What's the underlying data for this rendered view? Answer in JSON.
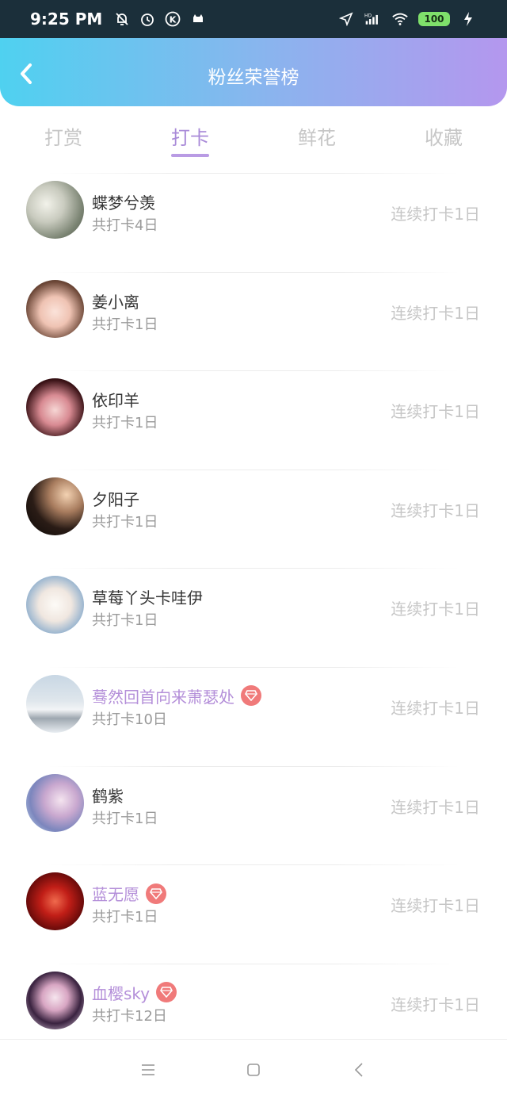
{
  "status_bar": {
    "time": "9:25 PM",
    "battery": "100",
    "icons": [
      "mute-bell-icon",
      "alarm-icon",
      "k-icon",
      "cat-icon",
      "location-icon",
      "signal-icon",
      "wifi-icon",
      "charging-icon"
    ]
  },
  "header": {
    "title": "粉丝荣誉榜",
    "back_icon": "chevron-left-icon"
  },
  "tabs": [
    {
      "label": "打赏",
      "active": false
    },
    {
      "label": "打卡",
      "active": true
    },
    {
      "label": "鲜花",
      "active": false
    },
    {
      "label": "收藏",
      "active": false
    }
  ],
  "fans": [
    {
      "name": "蝶梦兮羡",
      "total": "共打卡4日",
      "streak": "连续打卡1日",
      "vip": false
    },
    {
      "name": "姜小离",
      "total": "共打卡1日",
      "streak": "连续打卡1日",
      "vip": false
    },
    {
      "name": "依印羊",
      "total": "共打卡1日",
      "streak": "连续打卡1日",
      "vip": false
    },
    {
      "name": "夕阳子",
      "total": "共打卡1日",
      "streak": "连续打卡1日",
      "vip": false
    },
    {
      "name": "草莓丫头卡哇伊",
      "total": "共打卡1日",
      "streak": "连续打卡1日",
      "vip": false
    },
    {
      "name": "蓦然回首向来萧瑟处",
      "total": "共打卡10日",
      "streak": "连续打卡1日",
      "vip": true
    },
    {
      "name": "鹤紫",
      "total": "共打卡1日",
      "streak": "连续打卡1日",
      "vip": false
    },
    {
      "name": "蓝无愿",
      "total": "共打卡1日",
      "streak": "连续打卡1日",
      "vip": true
    },
    {
      "name": "血樱sky",
      "total": "共打卡12日",
      "streak": "连续打卡1日",
      "vip": true
    }
  ],
  "nav_bar": {
    "icons": [
      "menu-icon",
      "home-square-icon",
      "back-triangle-icon"
    ]
  },
  "colors": {
    "header_gradient_start": "#4fd1f0",
    "header_gradient_end": "#b497ee",
    "active_tab": "#a98ad8",
    "vip_name": "#b48fd9",
    "vip_badge": "#f07a7a"
  }
}
